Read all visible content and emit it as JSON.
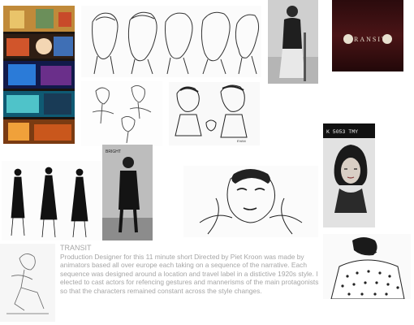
{
  "project": {
    "title": "TRANSIT",
    "description": "Production Designer  for this 11 minute short Directed by Piet Kroon was made by animators based all over europe each taking on a sequence of the narrative. Each sequence was designed around a location and travel label in a distictive 1920s style. I elected to cast actors for refencing gestures and mannerisms of the main protagonists so that the characters remained constant across the style changes."
  },
  "tiles": [
    {
      "name": "color-frames-strip"
    },
    {
      "name": "head-turnaround-sketch"
    },
    {
      "name": "actor-reference-photo-1"
    },
    {
      "name": "transit-title-card"
    },
    {
      "name": "poses-sketch-1"
    },
    {
      "name": "character-sketch-pair"
    },
    {
      "name": "flapper-poses-sketch"
    },
    {
      "name": "actor-reference-photo-2"
    },
    {
      "name": "woman-face-drawing"
    },
    {
      "name": "actress-portrait-photo"
    },
    {
      "name": "seated-figure-sketch"
    },
    {
      "name": "dress-figure-sketch"
    }
  ],
  "labels": {
    "title_card_text": "TRANSIT",
    "sheet_caption": "MARIE",
    "small_caption": "EVAN",
    "photo_strip_text": "K 5053 TMY",
    "photo_label": "BRIGHT"
  },
  "colors": {
    "text_gray": "#a6a6a6",
    "title_card_bg": "#3a1012"
  }
}
